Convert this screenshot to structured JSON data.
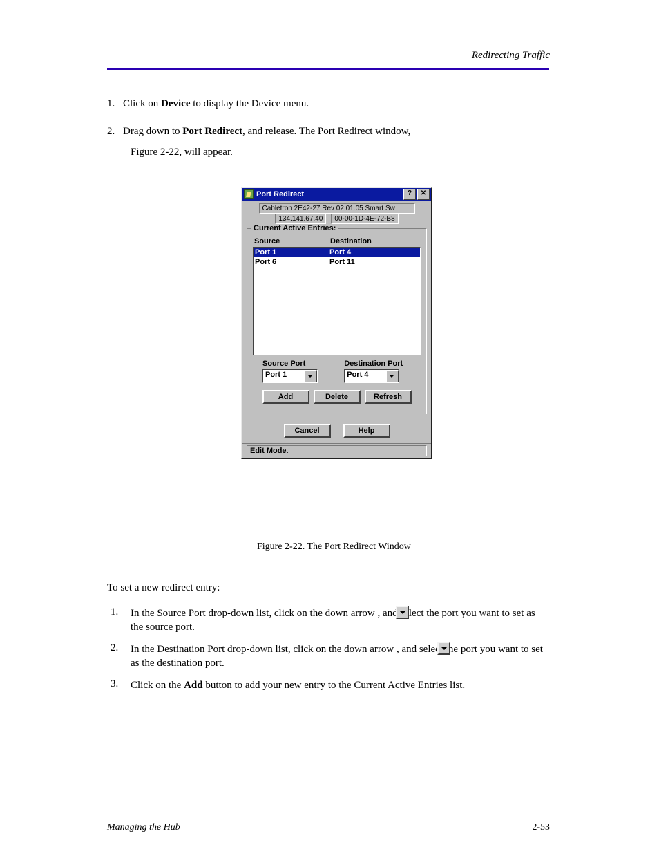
{
  "header": {
    "right_running": "Redirecting Traffic"
  },
  "body": {
    "p1_a": "Click on ",
    "p1_b": "Device",
    "p1_c": " to display the Device menu.",
    "p2_a": "Drag down to ",
    "p2_b": "Port Redirect",
    "p2_c": ", and release. The Port Redirect window,",
    "p3": "Figure 2-22, will appear.",
    "num1": "1.",
    "num2": "2."
  },
  "caption": "Figure 2-22. The Port Redirect Window",
  "setting": {
    "title": "To set a new redirect entry:",
    "s1_a": "In the Source Port drop-down list, click on the down arrow ",
    "s1_b": ", and select the port you want to set as the source port.",
    "s2_a": "In the Destination Port drop-down list, click on the down arrow ",
    "s2_b": ", and select the port you want to set as the destination port.",
    "s3_a": "Click on the ",
    "s3_b": "Add",
    "s3_c": " button to add your new entry to the Current Active Entries list.",
    "n1": "1.",
    "n2": "2.",
    "n3": "3."
  },
  "dialog": {
    "title": "Port Redirect",
    "help_btn": "?",
    "close_btn": "✕",
    "device_line": "Cabletron 2E42-27 Rev 02.01.05 Smart Sw",
    "ip": "134.141.67.40",
    "mac": "00-00-1D-4E-72-B8",
    "group_label": "Current Active Entries:",
    "col_source": "Source",
    "col_dest": "Destination",
    "rows": [
      {
        "src": "Port 1",
        "dst": "Port 4",
        "selected": true
      },
      {
        "src": "Port 6",
        "dst": "Port 11",
        "selected": false
      }
    ],
    "source_port_label": "Source Port",
    "dest_port_label": "Destination Port",
    "source_port_value": "Port 1",
    "dest_port_value": "Port 4",
    "add": "Add",
    "delete": "Delete",
    "refresh": "Refresh",
    "cancel": "Cancel",
    "help": "Help",
    "status": "Edit Mode."
  },
  "footer": {
    "left": "Managing the Hub",
    "right": "2-53"
  }
}
